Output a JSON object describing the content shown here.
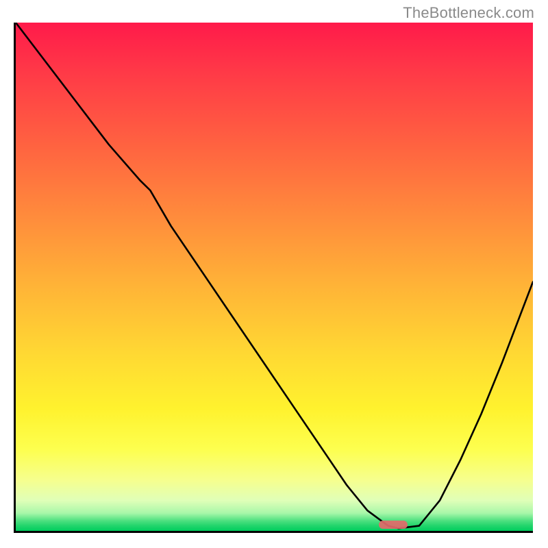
{
  "watermark": "TheBottleneck.com",
  "chart_data": {
    "type": "line",
    "title": "",
    "xlabel": "",
    "ylabel": "",
    "xlim": [
      0,
      100
    ],
    "ylim": [
      0,
      100
    ],
    "grid": false,
    "series": [
      {
        "name": "bottleneck-curve",
        "x": [
          0,
          6,
          12,
          18,
          24,
          26,
          30,
          36,
          42,
          48,
          54,
          60,
          64,
          68,
          72,
          74,
          78,
          82,
          86,
          90,
          94,
          100
        ],
        "y": [
          100,
          92,
          84,
          76,
          69,
          67,
          60,
          51,
          42,
          33,
          24,
          15,
          9,
          4,
          1,
          0.5,
          1,
          6,
          14,
          23,
          33,
          49
        ]
      }
    ],
    "annotations": [
      {
        "name": "optimal-marker",
        "x": 73,
        "y": 0.4,
        "width_pct": 5.5,
        "height_pct": 1.6
      }
    ],
    "gradient_stops": [
      {
        "pct": 0,
        "color": "#ff1a4a"
      },
      {
        "pct": 25,
        "color": "#ff6540"
      },
      {
        "pct": 52,
        "color": "#ffb437"
      },
      {
        "pct": 76,
        "color": "#fff22e"
      },
      {
        "pct": 94,
        "color": "#e0ffb8"
      },
      {
        "pct": 100,
        "color": "#00cc5e"
      }
    ]
  }
}
